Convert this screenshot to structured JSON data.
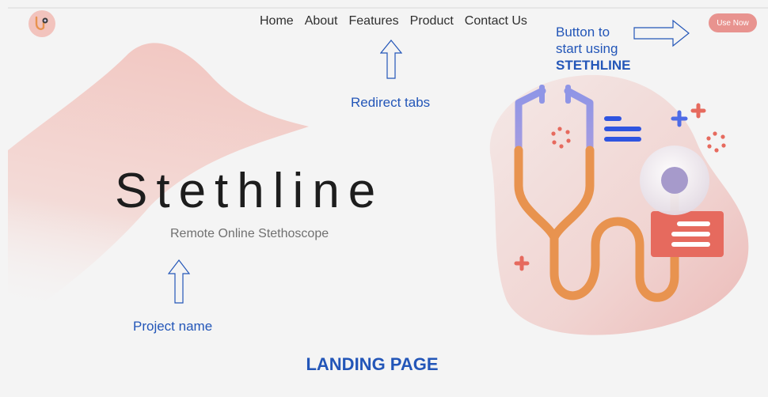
{
  "nav": {
    "items": [
      {
        "label": "Home"
      },
      {
        "label": "About"
      },
      {
        "label": "Features"
      },
      {
        "label": "Product"
      },
      {
        "label": "Contact Us"
      }
    ]
  },
  "header": {
    "use_now_label": "Use Now"
  },
  "hero": {
    "title": "Stethline",
    "subtitle": "Remote Online Stethoscope"
  },
  "annotations": {
    "button_line1": "Button to",
    "button_line2": "start using",
    "button_line3": "STETHLINE",
    "redirect_tabs": "Redirect tabs",
    "project_name": "Project name",
    "landing_page": "LANDING PAGE"
  },
  "colors": {
    "accent": "#e8938f",
    "annotation": "#2356b8",
    "stethoscope": "#e8934f",
    "tube_top": "#8f95e6"
  }
}
